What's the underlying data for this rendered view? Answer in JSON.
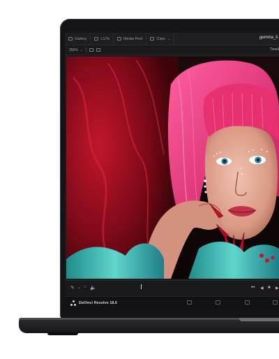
{
  "app": {
    "name": "DaVinci Resolve 18.6",
    "filename": "gemma_li"
  },
  "topbar": {
    "tabs": [
      {
        "label": "Gallery"
      },
      {
        "label": "LUTs"
      },
      {
        "label": "Media Pool"
      },
      {
        "label": "Clips"
      }
    ]
  },
  "viewer_bar": {
    "zoom": "255%",
    "timeline_label": "Timeli"
  },
  "colors": {
    "bezel": "#141416",
    "ui_dark": "#1b1b1d",
    "accent_red": "#b01226",
    "accent_pink": "#e2357d",
    "accent_teal": "#2fb7b0"
  },
  "icons": [
    "gallery-icon",
    "luts-icon",
    "media-pool-icon",
    "clips-icon",
    "pen-tool-icon",
    "speaker-icon",
    "resolve-logo-icon",
    "skip-back-icon",
    "play-back-icon",
    "stop-icon",
    "play-icon"
  ]
}
